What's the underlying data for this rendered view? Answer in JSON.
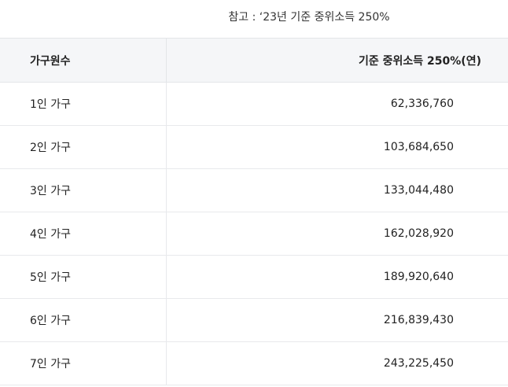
{
  "note": "참고 : ‘23년 기준 중위소득 250%",
  "table": {
    "headers": [
      "가구원수",
      "기준 중위소득 250%(연)"
    ],
    "rows": [
      {
        "household": "1인 가구",
        "income": "62,336,760"
      },
      {
        "household": "2인 가구",
        "income": "103,684,650"
      },
      {
        "household": "3인 가구",
        "income": "133,044,480"
      },
      {
        "household": "4인 가구",
        "income": "162,028,920"
      },
      {
        "household": "5인 가구",
        "income": "189,920,640"
      },
      {
        "household": "6인 가구",
        "income": "216,839,430"
      },
      {
        "household": "7인 가구",
        "income": "243,225,450"
      }
    ]
  }
}
